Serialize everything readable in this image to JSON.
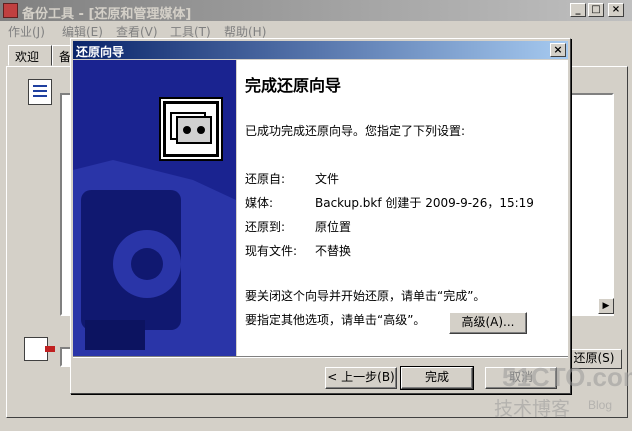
{
  "main_window": {
    "title": "备份工具 - [还原和管理媒体]",
    "controls": {
      "minimize": "_",
      "maximize": "□",
      "close": "×"
    }
  },
  "menubar": {
    "items": [
      "作业(J)",
      "编辑(E)",
      "查看(V)",
      "工具(T)",
      "帮助(H)"
    ]
  },
  "tabs": [
    "欢迎",
    "备"
  ],
  "background": {
    "restore_button": "还原(S)",
    "scroll_arrow": "▶",
    "icon_checklist": "checklist-icon",
    "icon_export": "export-icon"
  },
  "dialog": {
    "title": "还原向导",
    "close": "×",
    "heading": "完成还原向导",
    "intro": "已成功完成还原向导。您指定了下列设置:",
    "settings": [
      {
        "label": "还原自:",
        "value": "文件"
      },
      {
        "label": "媒体:",
        "value": "Backup.bkf 创建于 2009-9-26，15:19"
      },
      {
        "label": "还原到:",
        "value": "原位置"
      },
      {
        "label": "现有文件:",
        "value": "不替换"
      }
    ],
    "finish_hint": "要关闭这个向导并开始还原，请单击“完成”。",
    "advanced_hint": "要指定其他选项，请单击“高级”。",
    "advanced_button": "高级(A)...",
    "back_button": "< 上一步(B)",
    "finish_button": "完成",
    "cancel_button": "取消",
    "banner_icon": "backup-tape-icon"
  },
  "watermark": {
    "line1": "51CTO.com",
    "line2": "技术博客",
    "line3": "Blog"
  }
}
